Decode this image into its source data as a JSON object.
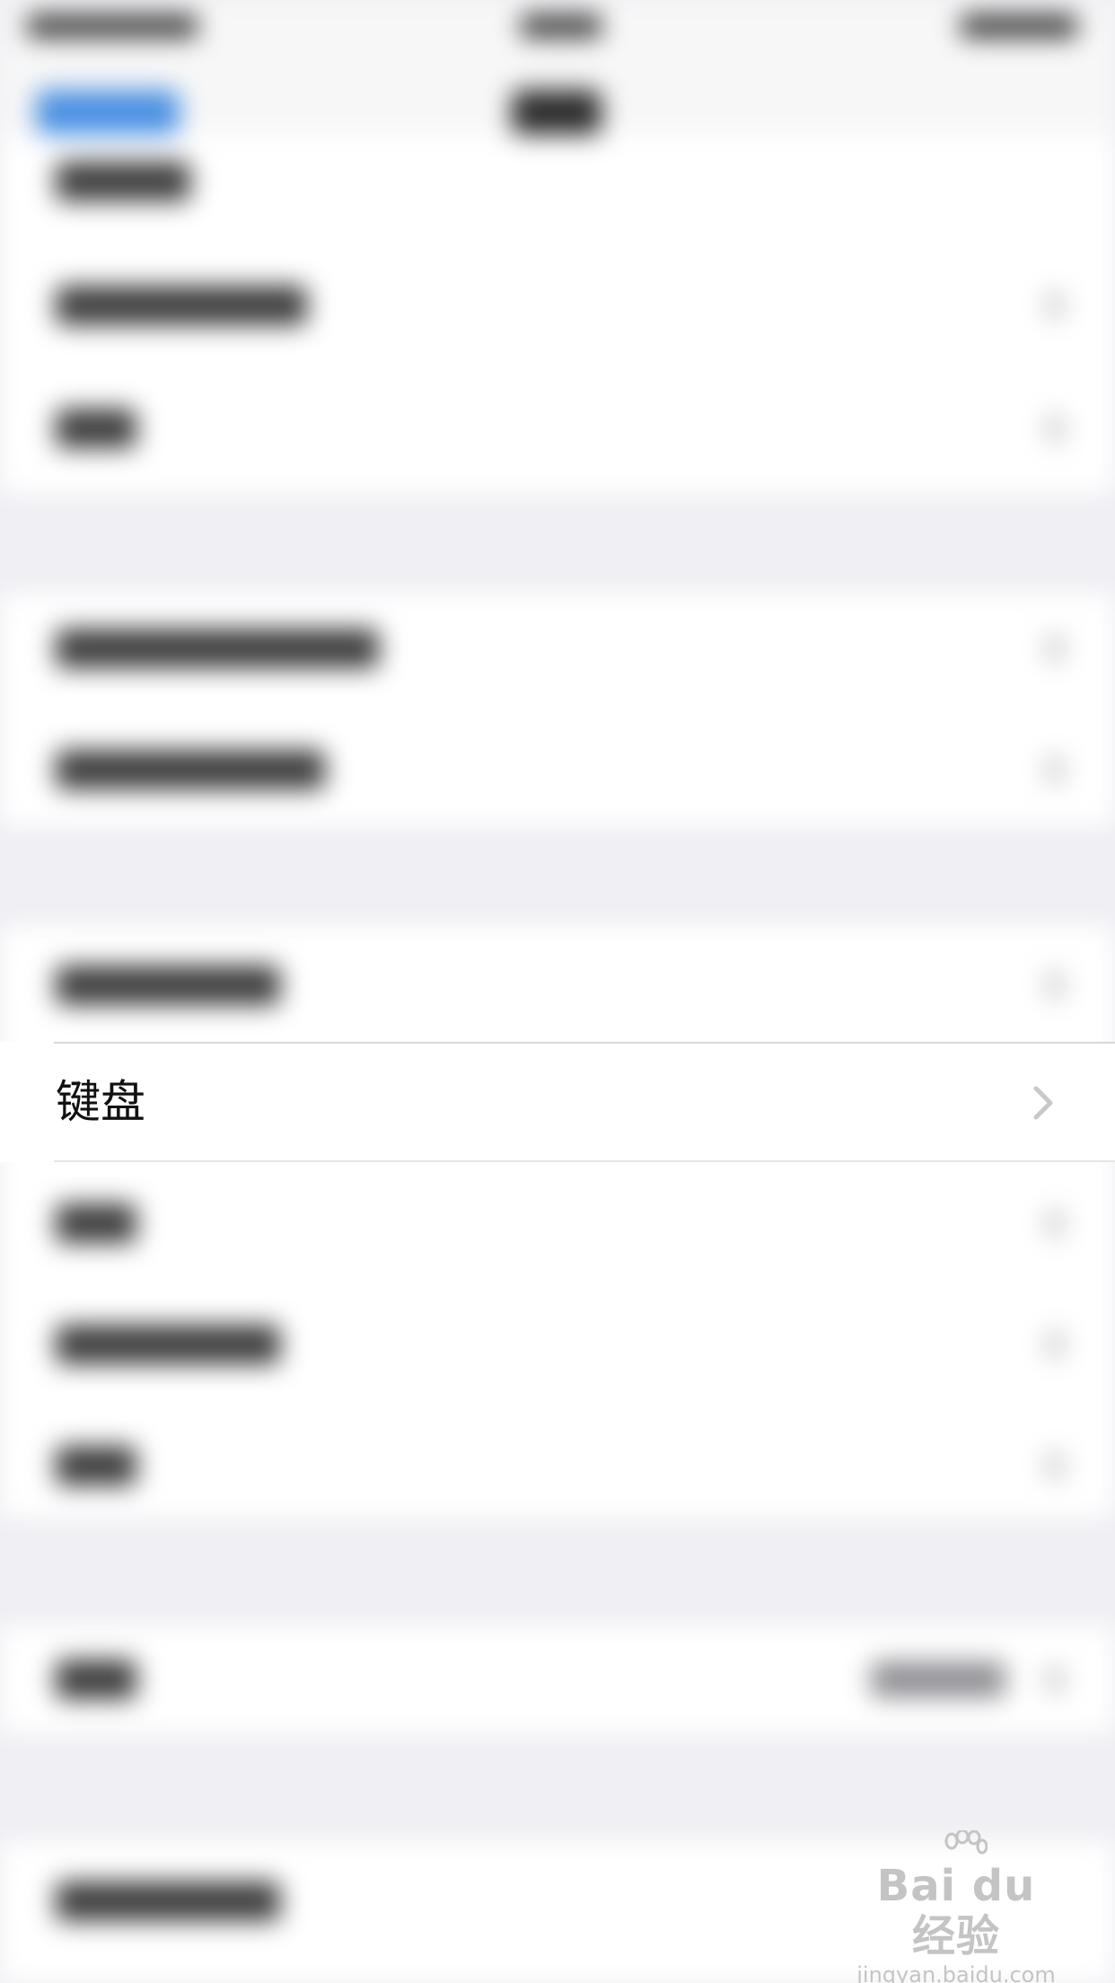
{
  "row": {
    "label": "键盘"
  },
  "icons": {
    "chevron": "chevron-right-icon",
    "watermark_paw": "paw-icon"
  },
  "watermark": {
    "logo": "Bai du 经验",
    "url": "jingyan.baidu.com"
  },
  "colors": {
    "background": "#efeff4",
    "cell": "#ffffff",
    "separator": "#d8d8dc",
    "chevron": "#c7c7cc",
    "text": "#111111",
    "watermark": "#c4c4c4"
  }
}
